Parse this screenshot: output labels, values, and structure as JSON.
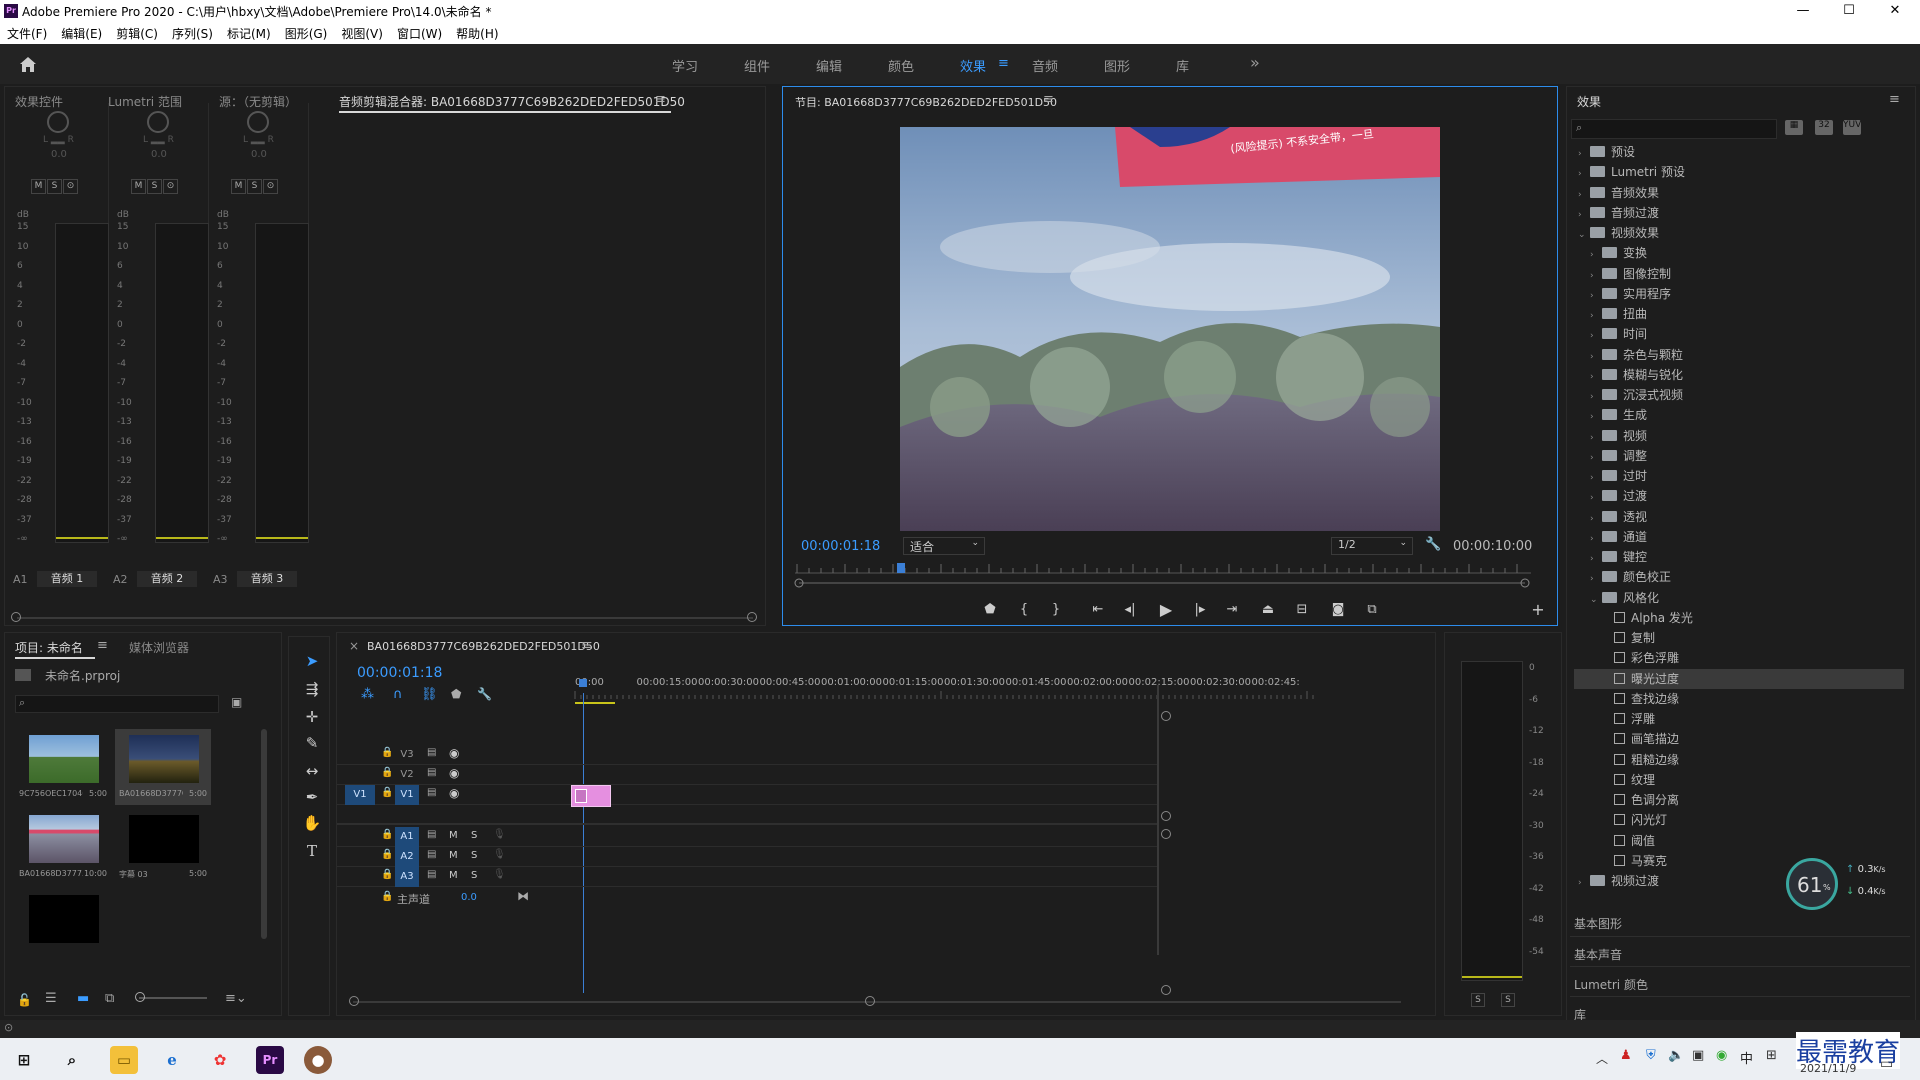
{
  "window": {
    "title": "Adobe Premiere Pro 2020 - C:\\用户\\hbxy\\文档\\Adobe\\Premiere Pro\\14.0\\未命名 *",
    "app_badge": "Pr",
    "min": "—",
    "max": "☐",
    "close": "✕"
  },
  "menu": [
    "文件(F)",
    "编辑(E)",
    "剪辑(C)",
    "序列(S)",
    "标记(M)",
    "图形(G)",
    "视图(V)",
    "窗口(W)",
    "帮助(H)"
  ],
  "workspaces": {
    "items": [
      "学习",
      "组件",
      "编辑",
      "颜色",
      "效果",
      "音频",
      "图形",
      "库"
    ],
    "active": "效果",
    "more": "»"
  },
  "top_left_panel": {
    "tabs": [
      "效果控件",
      "Lumetri 范围",
      "源：（无剪辑）",
      "音频剪辑混合器: BA01668D3777C69B262DED2FED501D50"
    ],
    "channels": [
      {
        "id": "A1",
        "name": "音频 1",
        "value": "0.0"
      },
      {
        "id": "A2",
        "name": "音频 2",
        "value": "0.0"
      },
      {
        "id": "A3",
        "name": "音频 3",
        "value": "0.0"
      }
    ],
    "msb": [
      "M",
      "S",
      "⊙"
    ],
    "lr": "L ▂▂ R",
    "db_unit": "dB",
    "db_ticks": [
      "15",
      "10",
      "6",
      "4",
      "2",
      "0",
      "-2",
      "-4",
      "-7",
      "-10",
      "-13",
      "-16",
      "-19",
      "-22",
      "-28",
      "-37",
      "-∞"
    ]
  },
  "program_monitor": {
    "title": "节目: BA01668D3777C69B262DED2FED501D50",
    "timecode": "00:00:01:18",
    "fit": "适合",
    "resolution": "1/2",
    "duration": "00:00:10:00",
    "overlay_text": "(风险提示) 不系安全带，一旦",
    "controls": [
      "marker",
      "in",
      "out",
      "goto-in",
      "step-back",
      "play",
      "step-forward",
      "goto-out",
      "lift",
      "extract",
      "export-frame",
      "compare"
    ]
  },
  "effects_panel": {
    "title": "效果",
    "search_placeholder": "",
    "tree": [
      {
        "label": "预设",
        "type": "folder",
        "level": 0,
        "expanded": false
      },
      {
        "label": "Lumetri 预设",
        "type": "folder",
        "level": 0,
        "expanded": false
      },
      {
        "label": "音频效果",
        "type": "folder",
        "level": 0,
        "expanded": false
      },
      {
        "label": "音频过渡",
        "type": "folder",
        "level": 0,
        "expanded": false
      },
      {
        "label": "视频效果",
        "type": "folder",
        "level": 0,
        "expanded": true
      },
      {
        "label": "变换",
        "type": "folder",
        "level": 1,
        "expanded": false
      },
      {
        "label": "图像控制",
        "type": "folder",
        "level": 1,
        "expanded": false
      },
      {
        "label": "实用程序",
        "type": "folder",
        "level": 1,
        "expanded": false
      },
      {
        "label": "扭曲",
        "type": "folder",
        "level": 1,
        "expanded": false
      },
      {
        "label": "时间",
        "type": "folder",
        "level": 1,
        "expanded": false
      },
      {
        "label": "杂色与颗粒",
        "type": "folder",
        "level": 1,
        "expanded": false
      },
      {
        "label": "模糊与锐化",
        "type": "folder",
        "level": 1,
        "expanded": false
      },
      {
        "label": "沉浸式视频",
        "type": "folder",
        "level": 1,
        "expanded": false
      },
      {
        "label": "生成",
        "type": "folder",
        "level": 1,
        "expanded": false
      },
      {
        "label": "视频",
        "type": "folder",
        "level": 1,
        "expanded": false
      },
      {
        "label": "调整",
        "type": "folder",
        "level": 1,
        "expanded": false
      },
      {
        "label": "过时",
        "type": "folder",
        "level": 1,
        "expanded": false
      },
      {
        "label": "过渡",
        "type": "folder",
        "level": 1,
        "expanded": false
      },
      {
        "label": "透视",
        "type": "folder",
        "level": 1,
        "expanded": false
      },
      {
        "label": "通道",
        "type": "folder",
        "level": 1,
        "expanded": false
      },
      {
        "label": "键控",
        "type": "folder",
        "level": 1,
        "expanded": false
      },
      {
        "label": "颜色校正",
        "type": "folder",
        "level": 1,
        "expanded": false
      },
      {
        "label": "风格化",
        "type": "folder",
        "level": 1,
        "expanded": true
      },
      {
        "label": "Alpha 发光",
        "type": "effect",
        "level": 2
      },
      {
        "label": "复制",
        "type": "effect",
        "level": 2
      },
      {
        "label": "彩色浮雕",
        "type": "effect",
        "level": 2
      },
      {
        "label": "曝光过度",
        "type": "effect",
        "level": 2,
        "selected": true
      },
      {
        "label": "查找边缘",
        "type": "effect",
        "level": 2
      },
      {
        "label": "浮雕",
        "type": "effect",
        "level": 2
      },
      {
        "label": "画笔描边",
        "type": "effect",
        "level": 2
      },
      {
        "label": "粗糙边缘",
        "type": "effect",
        "level": 2
      },
      {
        "label": "纹理",
        "type": "effect",
        "level": 2
      },
      {
        "label": "色调分离",
        "type": "effect",
        "level": 2
      },
      {
        "label": "闪光灯",
        "type": "effect",
        "level": 2
      },
      {
        "label": "阈值",
        "type": "effect",
        "level": 2
      },
      {
        "label": "马赛克",
        "type": "effect",
        "level": 2
      },
      {
        "label": "视频过渡",
        "type": "folder",
        "level": 0,
        "expanded": false
      }
    ],
    "sections": [
      "基本图形",
      "基本声音",
      "Lumetri 颜色",
      "库"
    ],
    "net_widget": {
      "cpu": "61",
      "unit": "%",
      "up": "0.3",
      "down": "0.4",
      "rate_unit": "K/s"
    }
  },
  "project_panel": {
    "tabs": [
      "项目: 未命名",
      "媒体浏览器"
    ],
    "project_file": "未命名.prproj",
    "items": [
      {
        "name": "9C756OEC17046...",
        "duration": "5:00",
        "thumb": "landscape"
      },
      {
        "name": "BA01668D3777C...",
        "duration": "5:00",
        "thumb": "night",
        "selected": true
      },
      {
        "name": "BA01668D3777...",
        "duration": "10:00",
        "thumb": "landscape2"
      },
      {
        "name": "字幕 03",
        "duration": "5:00",
        "thumb": "black"
      },
      {
        "name": "",
        "duration": "",
        "thumb": "black"
      }
    ]
  },
  "timeline": {
    "sequence_name": "BA01668D3777C69B262DED2FED501D50",
    "timecode": "00:00:01:18",
    "ruler": [
      "00:00",
      "00:00:15:00",
      "00:00:30:00",
      "00:00:45:00",
      "00:01:00:00",
      "00:01:15:00",
      "00:01:30:00",
      "00:01:45:00",
      "00:02:00:00",
      "00:02:15:00",
      "00:02:30:00",
      "00:02:45:"
    ],
    "video_tracks": [
      "V3",
      "V2",
      "V1"
    ],
    "audio_tracks": [
      "A1",
      "A2",
      "A3"
    ],
    "source_patch": "V1",
    "master": {
      "label": "主声道",
      "value": "0.0"
    },
    "track_buttons": {
      "m": "M",
      "s": "S"
    }
  },
  "audio_meter": {
    "ticks": [
      "0",
      "-6",
      "-12",
      "-18",
      "-24",
      "-30",
      "-36",
      "-42",
      "-48",
      "-54"
    ],
    "solo": [
      "S",
      "S"
    ]
  },
  "taskbar": {
    "clock": "2021/11/9",
    "ime": "中",
    "watermark": "最需教育"
  },
  "colors": {
    "accent": "#3b9cff",
    "clip_pink": "#e58fe0",
    "playhead": "#3b7fd6",
    "panel_bg": "#1d1d1d"
  }
}
